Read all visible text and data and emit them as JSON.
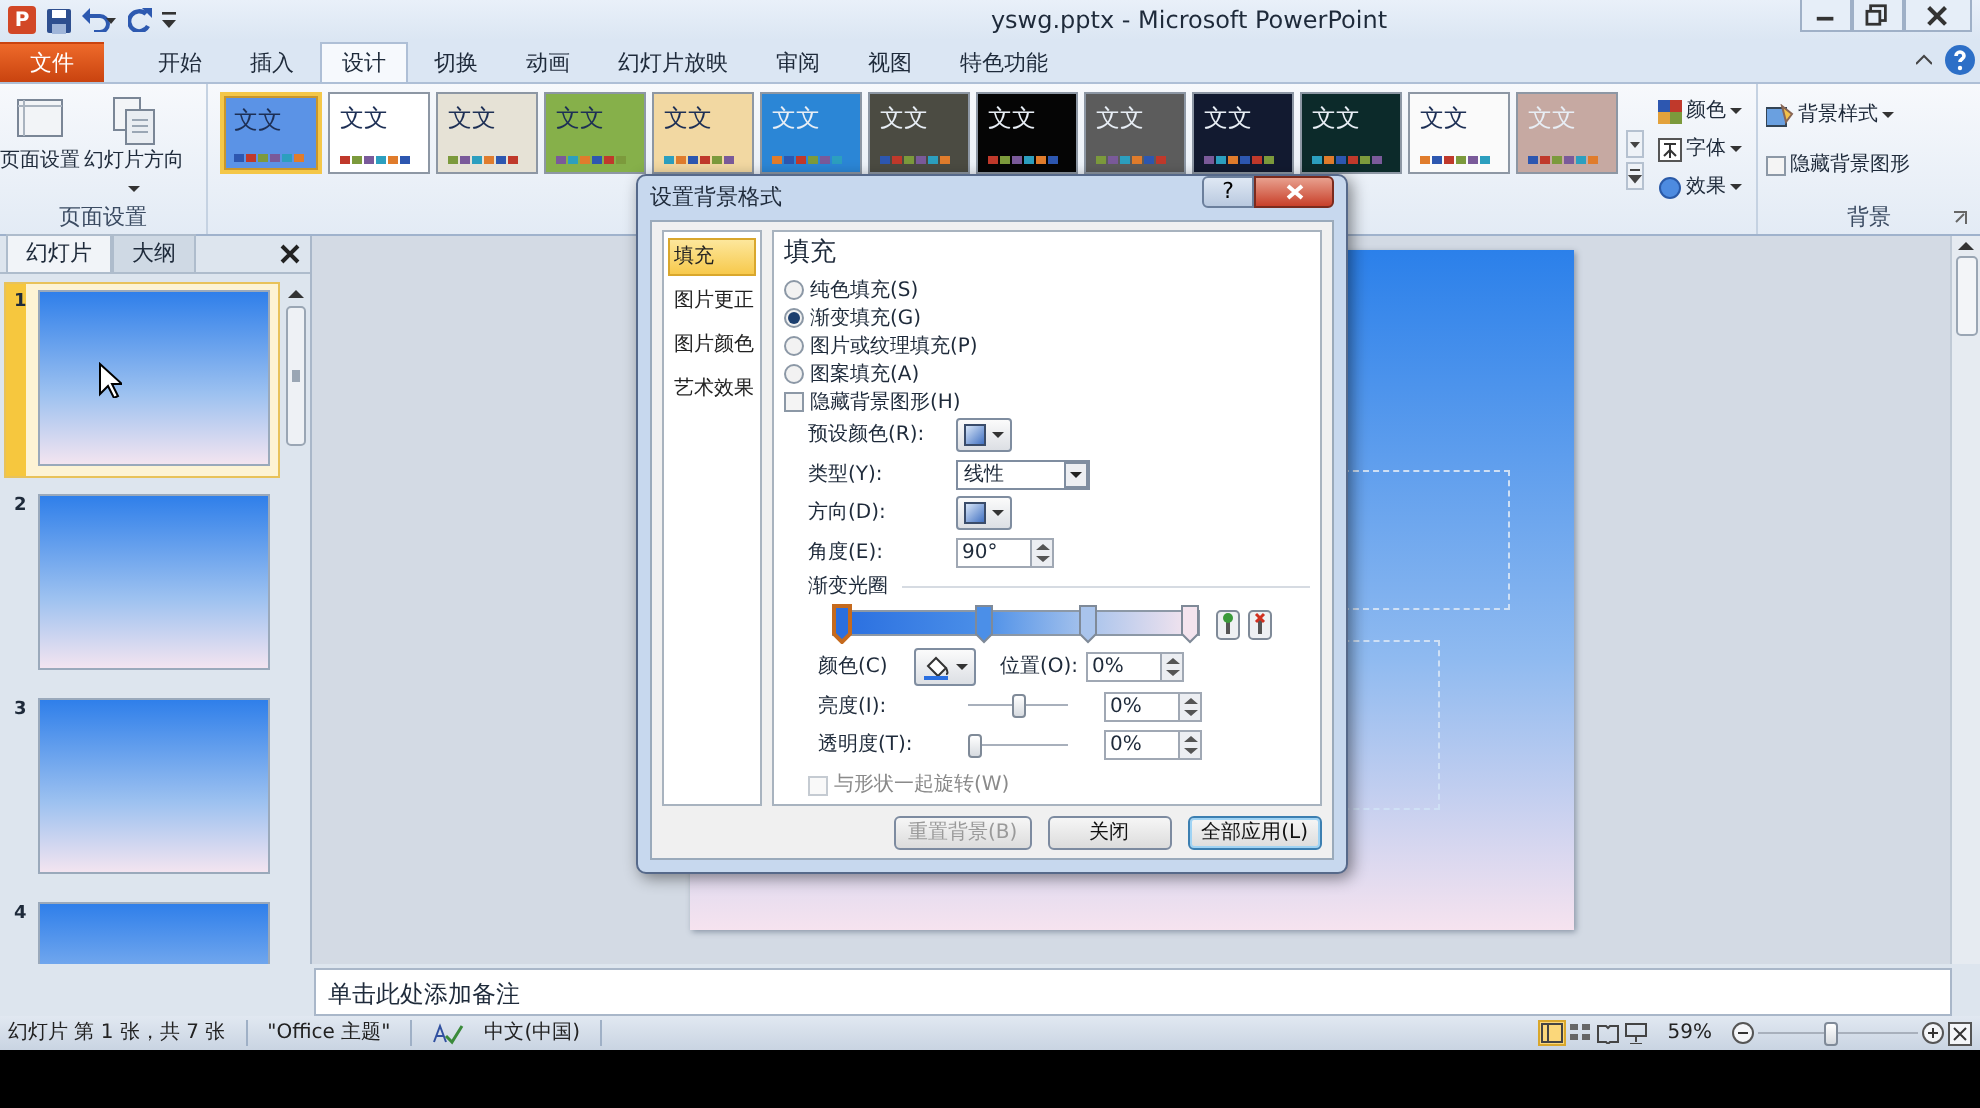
{
  "title_bar": {
    "app_icon_letter": "P",
    "title": "yswg.pptx - Microsoft PowerPoint"
  },
  "ribbon_tabs": [
    {
      "label": "文件",
      "kind": "file",
      "selected": false
    },
    {
      "label": "开始",
      "kind": "tab",
      "selected": false
    },
    {
      "label": "插入",
      "kind": "tab",
      "selected": false
    },
    {
      "label": "设计",
      "kind": "tab",
      "selected": true
    },
    {
      "label": "切换",
      "kind": "tab",
      "selected": false
    },
    {
      "label": "动画",
      "kind": "tab",
      "selected": false
    },
    {
      "label": "幻灯片放映",
      "kind": "tab",
      "selected": false
    },
    {
      "label": "审阅",
      "kind": "tab",
      "selected": false
    },
    {
      "label": "视图",
      "kind": "tab",
      "selected": false
    },
    {
      "label": "特色功能",
      "kind": "tab",
      "selected": false
    }
  ],
  "page_setup_group": {
    "buttons": [
      {
        "label": "页面设置",
        "dropdown": false
      },
      {
        "label": "幻灯片方向",
        "dropdown": true
      }
    ],
    "group_label": "页面设置"
  },
  "themes": [
    {
      "label": "文文",
      "color": "#5b93e6",
      "kind": "light",
      "selected": true
    },
    {
      "label": "文文",
      "color": "#ffffff",
      "kind": "light",
      "selected": false
    },
    {
      "label": "文文",
      "color": "#e6e2d6",
      "kind": "light",
      "selected": false
    },
    {
      "label": "文文",
      "color": "#86b04a",
      "kind": "light",
      "selected": false
    },
    {
      "label": "文文",
      "color": "#f2d8a2",
      "kind": "light",
      "selected": false
    },
    {
      "label": "文文",
      "color": "#2b86d6",
      "kind": "dark",
      "selected": false
    },
    {
      "label": "文文",
      "color": "#4b4b42",
      "kind": "dark",
      "selected": false
    },
    {
      "label": "文文",
      "color": "#050505",
      "kind": "dark",
      "selected": false
    },
    {
      "label": "文文",
      "color": "#5c5c5c",
      "kind": "dark",
      "selected": false
    },
    {
      "label": "文文",
      "color": "#121a30",
      "kind": "dark",
      "selected": false
    },
    {
      "label": "文文",
      "color": "#0c2a2a",
      "kind": "dark",
      "selected": false
    },
    {
      "label": "文文",
      "color": "#fafafa",
      "kind": "light",
      "selected": false
    },
    {
      "label": "文文",
      "color": "#c6a9a2",
      "kind": "dark",
      "selected": false
    }
  ],
  "theme_options": [
    {
      "label": "颜色"
    },
    {
      "label": "字体"
    },
    {
      "label": "效果"
    }
  ],
  "background_group": {
    "style_button": "背景样式",
    "hide_graphics": {
      "label": "隐藏背景图形",
      "checked": false
    },
    "group_label": "背景"
  },
  "slides_pane": {
    "tabs": [
      {
        "label": "幻灯片",
        "selected": true
      },
      {
        "label": "大纲",
        "selected": false
      }
    ],
    "slides": [
      {
        "number": "1",
        "selected": true
      },
      {
        "number": "2",
        "selected": false
      },
      {
        "number": "3",
        "selected": false
      },
      {
        "number": "4",
        "selected": false
      }
    ]
  },
  "notes_placeholder": "单击此处添加备注",
  "status_bar": {
    "slide_info": "幻灯片 第 1 张，共 7 张",
    "theme": "\"Office 主题\"",
    "language": "中文(中国)",
    "views": [
      {
        "selected": true
      },
      {
        "selected": false
      },
      {
        "selected": false
      },
      {
        "selected": false
      }
    ],
    "zoom": "59%",
    "zoom_slider": {
      "level": 0.45
    }
  },
  "dialog": {
    "title": "设置背景格式",
    "help": "?",
    "categories": [
      {
        "label": "填充",
        "selected": true
      },
      {
        "label": "图片更正",
        "selected": false
      },
      {
        "label": "图片颜色",
        "selected": false
      },
      {
        "label": "艺术效果",
        "selected": false
      }
    ],
    "heading": "填充",
    "fill_options": [
      {
        "label": "纯色填充(S)",
        "selected": false
      },
      {
        "label": "渐变填充(G)",
        "selected": true
      },
      {
        "label": "图片或纹理填充(P)",
        "selected": false
      },
      {
        "label": "图案填充(A)",
        "selected": false
      }
    ],
    "hide_graphics": {
      "label": "隐藏背景图形(H)",
      "checked": false,
      "disabled": false
    },
    "preset_label": "预设颜色(R):",
    "type_label": "类型(Y):",
    "type_value": "线性",
    "direction_label": "方向(D):",
    "angle_label": "角度(E):",
    "angle_value": "90°",
    "stops_label": "渐变光圈",
    "gradient_stops": [
      {
        "level": 0.02,
        "color": "#2a6fe0",
        "selected": true
      },
      {
        "level": 0.41,
        "color": "#4b8fe8",
        "selected": false
      },
      {
        "level": 0.7,
        "color": "#a9c4ec",
        "selected": false
      },
      {
        "level": 0.98,
        "color": "#f4e4ee",
        "selected": false
      }
    ],
    "color_label": "颜色(C)",
    "position_label": "位置(O):",
    "position_value": "0%",
    "brightness_label": "亮度(I):",
    "brightness": {
      "level": 0.5
    },
    "brightness_value": "0%",
    "transparency_label": "透明度(T):",
    "transparency": {
      "level": 0
    },
    "transparency_value": "0%",
    "rotate": {
      "label": "与形状一起旋转(W)",
      "checked": false,
      "disabled": true
    },
    "buttons": [
      {
        "label": "重置背景(B)",
        "kind": "normal",
        "disabled": true
      },
      {
        "label": "关闭",
        "kind": "normal",
        "disabled": false
      },
      {
        "label": "全部应用(L)",
        "kind": "default",
        "disabled": false
      }
    ]
  }
}
